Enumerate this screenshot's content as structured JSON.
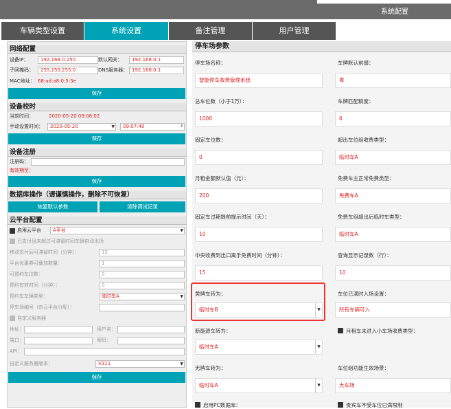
{
  "window": {
    "title": "系统配置"
  },
  "tabs": [
    {
      "label": "车辆类型设置"
    },
    {
      "label": "系统设置"
    },
    {
      "label": "备注管理"
    },
    {
      "label": "用户管理"
    }
  ],
  "network": {
    "header": "网络配置",
    "ip_label": "设备IP：",
    "ip_value": "192.168.0.250",
    "gw_label": "默认网关：",
    "gw_value": "192.168.0.1",
    "mask_label": "子网掩码：",
    "mask_value": "255.255.255.0",
    "dns_label": "DNS服务器：",
    "dns_value": "192.168.0.1",
    "mac_label": "MAC地址：",
    "mac_value": "68:ad:a8:0:5:3e",
    "save": "保存"
  },
  "timecal": {
    "header": "设备校时",
    "cur_label": "当前时间：",
    "cur_value": "2020-05-20 09:08:02",
    "manual_label": "手动设置时间：",
    "date_value": "2020-05-20",
    "time_value": "09:07:40",
    "save": "保存"
  },
  "register": {
    "header": "设备注册",
    "code_label": "注册码：",
    "expire_label": "有效期至：",
    "save": "保存"
  },
  "db": {
    "header": "数据库操作（请谨慎操作，删除不可恢复）",
    "restore": "恢复默认参数",
    "clear": "清除调试记录"
  },
  "cloud": {
    "header": "云平台配置",
    "enable_label": "启用云平台",
    "enable_value": "A平台",
    "auto_exit": "已支付且未超过可滞留时间车辆自动出场",
    "move_pay_label": "移动支付后可滞留时间（分钟）：",
    "move_pay_value": "15",
    "coupon_label": "平台优惠券可叠加数量：",
    "coupon_value": "1",
    "reserve_label": "可预约车位数：",
    "reserve_value": "0",
    "reserve_time_label": "预约有效时间（分钟）：",
    "reserve_time_value": "0",
    "reserve_type_label": "预约车车辆类型：",
    "reserve_type_value": "临时车A",
    "lot_code_label": "停车场编号（由云平台分配）：",
    "custom_server": "自定义服务器",
    "addr_label": "地址：",
    "user_label": "用户名：",
    "port_label": "端口：",
    "pwd_label": "密码：",
    "api_label": "API：",
    "ver_label": "自定义服务器版本：",
    "ver_value": "V311",
    "save": "保存"
  },
  "parking": {
    "header": "停车场参数",
    "name_label": "停车场名称：",
    "name_value": "智能停车收费管理系统",
    "prefix_label": "车牌默认前缀：",
    "prefix_value": "粤",
    "total_label": "总车位数（小于1万）：",
    "total_value": "1000",
    "match_label": "车牌匹配精度：",
    "match_value": "6",
    "fixed_label": "固定车位数：",
    "fixed_value": "0",
    "over_type_label": "超出车位组收费类型：",
    "over_type_value": "临时车A",
    "monthly_label": "月租金额默认值（元）：",
    "monthly_value": "200",
    "free_main_label": "免费车主正常免费类型：",
    "free_main_value": "免费车A",
    "expire_label": "固定车过期提前提示时间（天）：",
    "expire_value": "10",
    "free_over_label": "免费车组超出后临时车类型：",
    "free_over_value": "临时车A",
    "central_label": "中央收费到出口离手免费时间（分钟）：",
    "central_value": "15",
    "query_label": "查询显示记录数（行）：",
    "query_value": "10",
    "yellow_label": "黄牌车转为：",
    "yellow_value": "临时车B",
    "full_label": "车位已满时入场设置：",
    "full_value": "所有车辆可入",
    "energy_label": "新能源车转为：",
    "energy_value": "临时车A",
    "monthly_small_label": "月租车未进入小车场收费类型：",
    "noplate_label": "无牌车转为：",
    "noplate_value": "临时车A",
    "group_label": "车位组功能生效场景：",
    "group_value": "大车场",
    "pc_db_label": "启用PC数据库：",
    "guest_label": "贵宾车不受车位已满限制"
  }
}
